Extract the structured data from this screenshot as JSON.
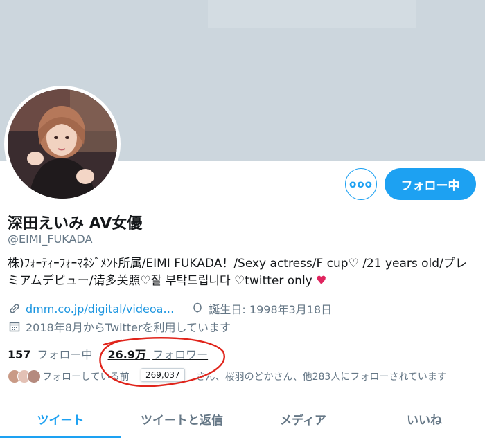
{
  "profile": {
    "name": "深田えいみ AV女優",
    "handle": "@EIMI_FUKADA",
    "bio": "株)ﾌｫｰﾃｨｰﾌｫｰﾏﾈｼﾞﾒﾝﾄ所属/EIMI FUKADA！/Sexy actress/F cup♡ /21 years old/プレミアムデビュー/请多关照♡잘 부탁드립니다 ♡twitter only",
    "bio_heart": "♥",
    "website": "dmm.co.jp/digital/videoa…",
    "birthday": "誕生日: 1998年3月18日",
    "joined": "2018年8月からTwitterを利用しています"
  },
  "buttons": {
    "more_label": "ooo",
    "follow_label": "フォロー中"
  },
  "stats": {
    "following_count": "157",
    "following_label": "フォロー中",
    "followers_count": "26.9万",
    "followers_label": "フォロワー",
    "followers_tooltip": "269,037"
  },
  "followed_by": {
    "prefix": "フォローしている前",
    "suffix": "さん、桜羽のどかさん、他283人にフォローされています"
  },
  "tabs": [
    {
      "label": "ツイート",
      "active": true
    },
    {
      "label": "ツイートと返信",
      "active": false
    },
    {
      "label": "メディア",
      "active": false
    },
    {
      "label": "いいね",
      "active": false
    }
  ],
  "colors": {
    "accent": "#1da1f2",
    "banner": "#ccd6dd",
    "secondary_text": "#657786",
    "annotation": "#e0241b"
  }
}
